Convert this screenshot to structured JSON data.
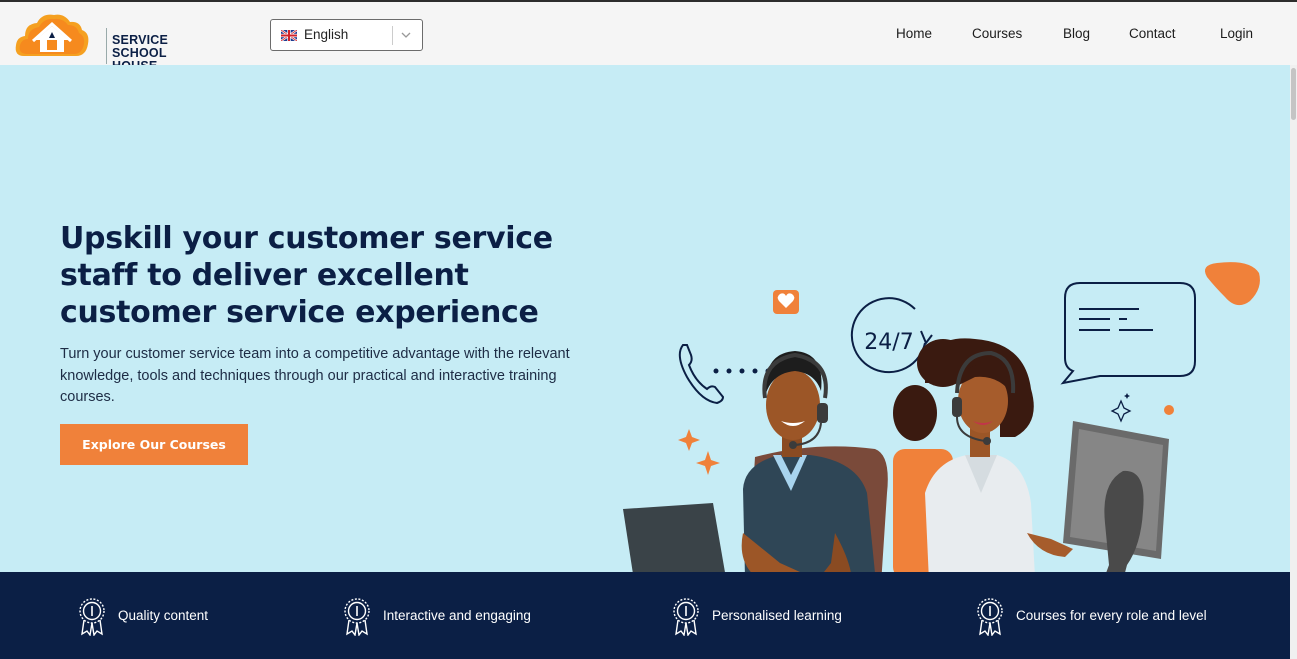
{
  "brand": {
    "line1": "SERVICE",
    "line2": "SCHOOL HOUSE"
  },
  "language": {
    "selected": "English"
  },
  "nav": {
    "items": [
      "Home",
      "Courses",
      "Blog",
      "Contact",
      "Login"
    ]
  },
  "hero": {
    "headline_lines": [
      "Upskill your customer service",
      "staff to deliver excellent",
      "customer service experience"
    ],
    "subtitle": "Turn your customer service team into a competitive advantage with the relevant knowledge, tools and techniques through our practical and interactive training courses.",
    "cta_label": "Explore Our Courses",
    "badge_text": "24/7"
  },
  "features": [
    "Quality content",
    "Interactive and engaging",
    "Personalised learning",
    "Courses for every role and level"
  ],
  "colors": {
    "navy": "#0b1f45",
    "accent_orange": "#f0813a",
    "hero_bg": "#c6ecf5"
  },
  "icons": [
    "house-cloud-logo-icon",
    "uk-flag-icon",
    "chevron-down-icon",
    "award-ribbon-icon",
    "phone-icon",
    "heart-icon",
    "chat-bubble-icon",
    "sparkle-icon"
  ]
}
